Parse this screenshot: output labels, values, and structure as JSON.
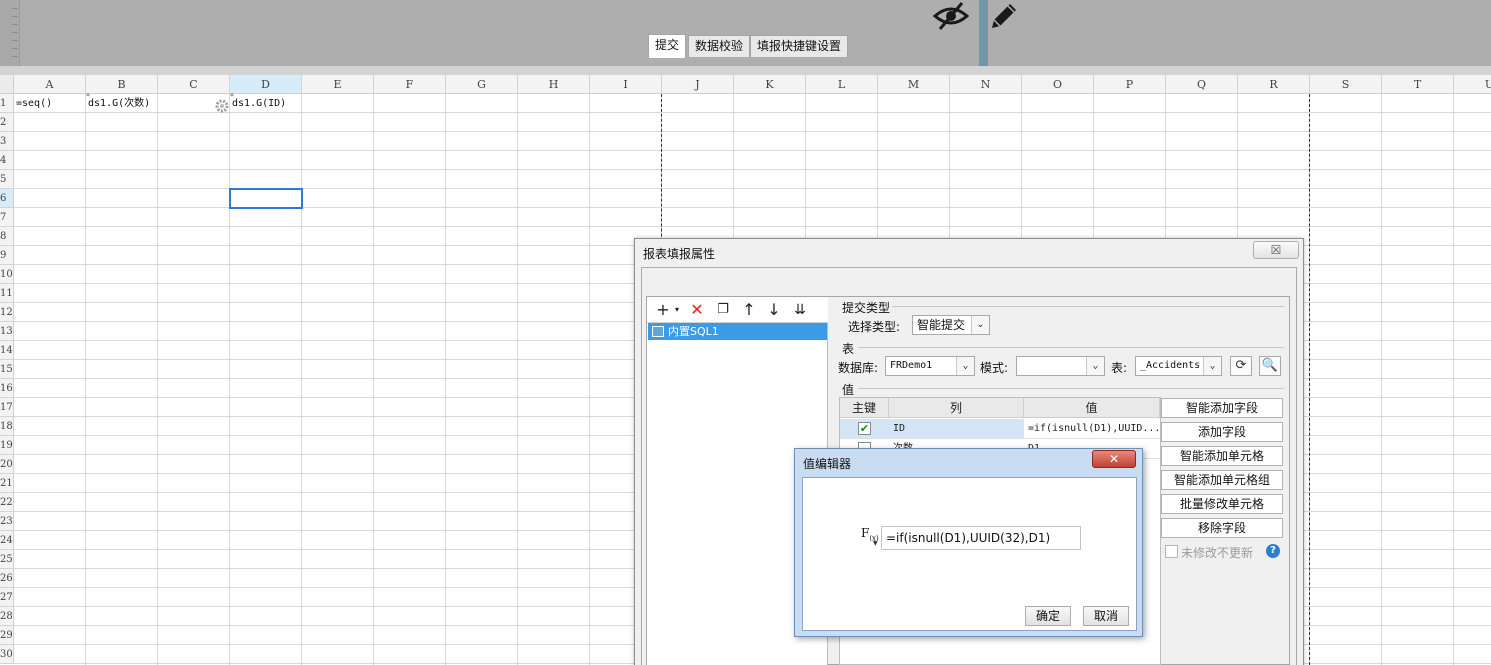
{
  "columns": [
    "A",
    "B",
    "C",
    "D",
    "E",
    "F",
    "G",
    "H",
    "I",
    "J",
    "K",
    "L",
    "M",
    "N",
    "O",
    "P",
    "Q",
    "R",
    "S",
    "T",
    "U"
  ],
  "selected_column": "D",
  "rows": [
    "1",
    "2",
    "3",
    "4",
    "5",
    "6",
    "7",
    "8",
    "9",
    "10",
    "11",
    "12",
    "13",
    "14",
    "15",
    "16",
    "17",
    "18",
    "19",
    "20",
    "21",
    "22",
    "23",
    "24",
    "25",
    "26",
    "27",
    "28",
    "29",
    "30"
  ],
  "selected_row": "6",
  "cells": {
    "a1": "=seq()",
    "b1": "ds1.G(次数)",
    "d1": "ds1.G(ID)"
  },
  "dialog": {
    "title": "报表填报属性",
    "close_label": "☒",
    "tabs": [
      "提交",
      "数据校验",
      "填报快捷键设置"
    ],
    "tree_item": "内置SQL1",
    "submit_type_heading": "提交类型",
    "select_type_label": "选择类型:",
    "select_type_value": "智能提交",
    "table_heading": "表",
    "db_label": "数据库:",
    "db_value": "FRDemo1",
    "mode_label": "模式:",
    "mode_value": "",
    "table_label": "表:",
    "table_value": "_Accidents",
    "value_heading": "值",
    "grid_headers": [
      "主键",
      "列",
      "值"
    ],
    "grid_rows": [
      {
        "key": "✔",
        "column": "ID",
        "value": "=if(isnull(D1),UUID..."
      },
      {
        "key": "",
        "column": "次数",
        "value": "D1"
      }
    ],
    "side_buttons": [
      "智能添加字段",
      "添加字段",
      "智能添加单元格",
      "智能添加单元格组",
      "批量修改单元格",
      "移除字段"
    ],
    "no_update_label": "未修改不更新"
  },
  "value_editor": {
    "title": "值编辑器",
    "close_label": "✕",
    "fx_label": "F",
    "fx_sub": "(x)",
    "formula": "=if(isnull(D1),UUID(32),D1)",
    "ok_label": "确定",
    "cancel_label": "取消"
  },
  "colors": {
    "toolbar_bg": "#aeaeae",
    "selection_border": "#2c7bd5",
    "list_selected_bg": "#3c9be7",
    "value_editor_frame": "#c9dcf2",
    "close_red": "#c2412f"
  }
}
